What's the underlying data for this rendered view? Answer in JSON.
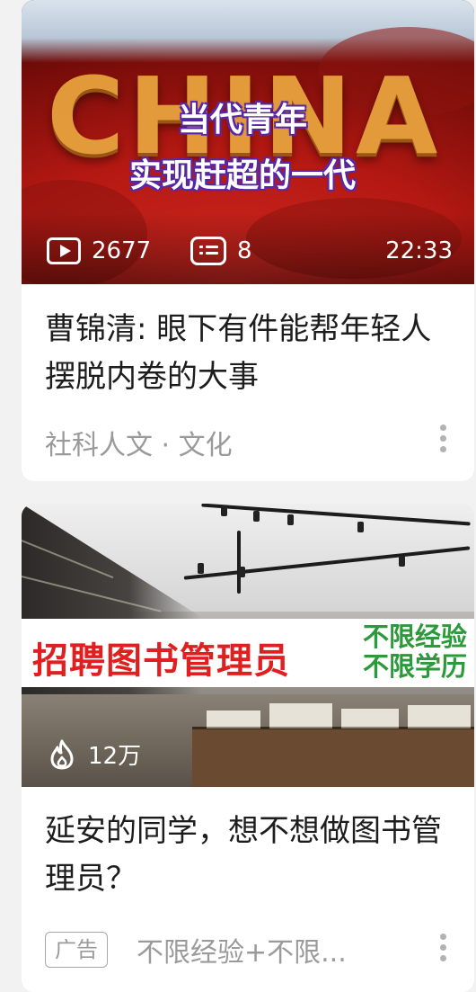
{
  "feed": {
    "cards": [
      {
        "thumbnail": {
          "background_word": "CHINA",
          "overlay_line1": "当代青年",
          "overlay_line2": "实现赶超的一代",
          "play_count": "2677",
          "comment_count": "8",
          "duration": "22:33"
        },
        "title": "曹锦清: 眼下有件能帮年轻人摆脱内卷的大事",
        "category": "社科人文 · 文化"
      },
      {
        "thumbnail": {
          "banner_left": "招聘图书管理员",
          "banner_right_line1": "不限经验",
          "banner_right_line2": "不限学历",
          "heat_count": "12万"
        },
        "title": "延安的同学，想不想做图书管理员？",
        "ad_label": "广告",
        "ad_description": "不限经验+不限..."
      }
    ]
  },
  "colors": {
    "page_bg": "#f2f2f2",
    "card_bg": "#ffffff",
    "title_text": "#1d1d1d",
    "meta_text": "#9a9a9a",
    "banner_red": "#e02020",
    "banner_green": "#2c9a3a"
  },
  "icons": [
    "play-icon",
    "comment-list-icon",
    "fire-icon",
    "more-vertical-icon"
  ]
}
